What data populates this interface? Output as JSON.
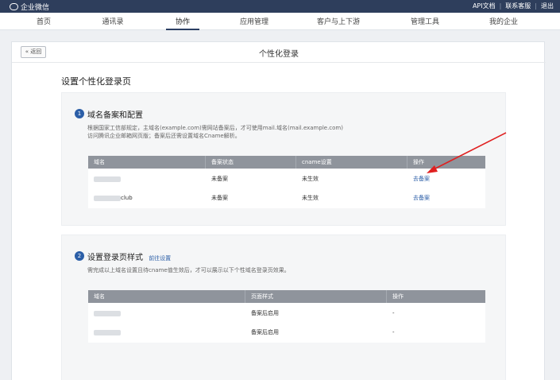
{
  "app": {
    "name": "企业微信"
  },
  "top_links": [
    "API文档",
    "联系客服",
    "退出"
  ],
  "nav": [
    {
      "label": "首页",
      "active": false
    },
    {
      "label": "通讯录",
      "active": false
    },
    {
      "label": "协作",
      "active": true
    },
    {
      "label": "应用管理",
      "active": false
    },
    {
      "label": "客户与上下游",
      "active": false
    },
    {
      "label": "管理工具",
      "active": false
    },
    {
      "label": "我的企业",
      "active": false
    }
  ],
  "panel": {
    "back_label": "« 返回",
    "title": "个性化登录"
  },
  "page_heading": "设置个性化登录页",
  "section1": {
    "step": "1",
    "title": "域名备案和配置",
    "desc_line1": "根据国家工信部规定，主域名(example.com)需网站备案后，才可使用mail.域名(mail.example.com)",
    "desc_line2": "访问腾讯企业邮箱网页版；备案后还需设置域名Cname解析。",
    "columns": [
      "域名",
      "备案状态",
      "cname设置",
      "操作"
    ],
    "rows": [
      {
        "domain": "",
        "status": "未备案",
        "cname": "未生效",
        "action": "去备案"
      },
      {
        "domain": "club",
        "status": "未备案",
        "cname": "未生效",
        "action": "去备案"
      }
    ]
  },
  "section2": {
    "step": "2",
    "title": "设置登录页样式",
    "link": "前往设置",
    "desc": "需完成以上域名设置且待cname值生效后，才可以展示以下个性域名登录页效果。",
    "columns": [
      "域名",
      "页面样式",
      "操作"
    ],
    "rows": [
      {
        "domain": "",
        "style": "备案后启用",
        "action": "-"
      },
      {
        "domain": "",
        "style": "备案后启用",
        "action": "-"
      }
    ]
  },
  "colors": {
    "topbar": "#2e3e5c",
    "accent": "#2b5ea7",
    "arrow": "#e02020",
    "table_header": "#8f949c"
  }
}
